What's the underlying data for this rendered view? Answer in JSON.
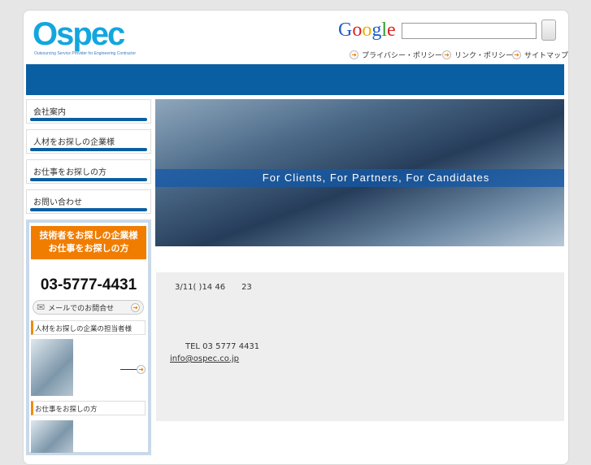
{
  "header": {
    "logo": "Ospec",
    "tagline": "Outsourcing Service Provider for Engineering Contractor",
    "google": "Google",
    "search_value": "",
    "links": [
      "プライバシー・ポリシー",
      "リンク・ポリシー",
      "サイトマップ"
    ]
  },
  "nav": [
    "会社案内",
    "人材をお探しの企業様",
    "お仕事をお探しの方",
    "お問い合わせ"
  ],
  "side": {
    "banner_line1": "技術者をお探しの企業様",
    "banner_line2": "お仕事をお探しの方",
    "phone": "03-5777-4431",
    "mail_label": "メールでのお問合せ",
    "head1": "人材をお探しの企業の担当者様",
    "head2": "お仕事をお探しの方"
  },
  "hero": {
    "tagline": "For Clients, For Partners, For Candidates"
  },
  "notice": {
    "line1": "3/11( )14 46　　23",
    "tel": "TEL 03 5777 4431",
    "email": "info@ospec.co.jp"
  },
  "colors": {
    "blue": "#0a5fa3",
    "orange": "#f07d00",
    "cyan": "#12a6de"
  }
}
